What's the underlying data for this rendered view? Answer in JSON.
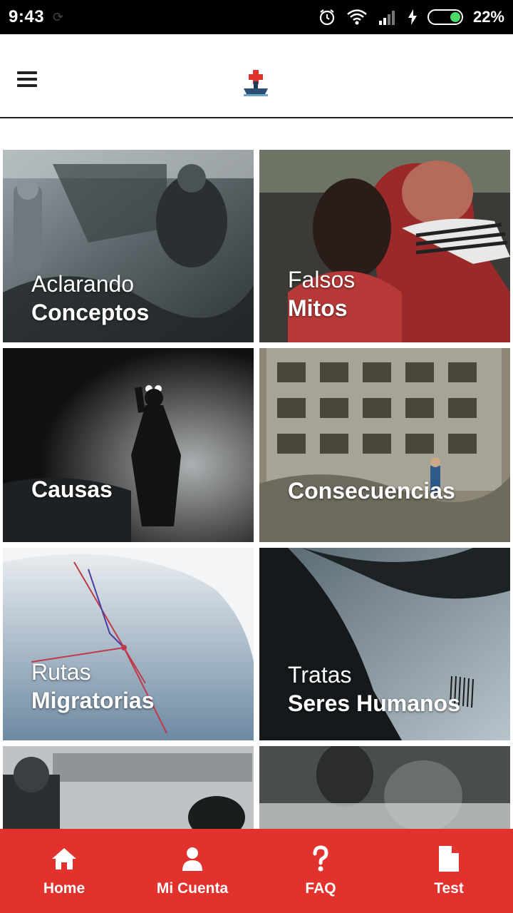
{
  "status_bar": {
    "time": "9:43",
    "battery": "22%"
  },
  "app": {
    "logo_icon": "red-cross-boat-logo"
  },
  "tiles": [
    {
      "line1": "Aclarando",
      "line2": "Conceptos"
    },
    {
      "line1": "Falsos",
      "line2": "Mitos"
    },
    {
      "line1": "",
      "line2": "Causas"
    },
    {
      "line1": "",
      "line2": "Consecuencias"
    },
    {
      "line1": "Rutas",
      "line2": "Migratorias"
    },
    {
      "line1": "Tratas",
      "line2": "Seres Humanos"
    }
  ],
  "bottom_nav": [
    {
      "label": "Home",
      "icon": "home-icon"
    },
    {
      "label": "Mi Cuenta",
      "icon": "user-icon"
    },
    {
      "label": "FAQ",
      "icon": "question-icon"
    },
    {
      "label": "Test",
      "icon": "document-icon"
    }
  ],
  "colors": {
    "accent": "#e1322d"
  }
}
